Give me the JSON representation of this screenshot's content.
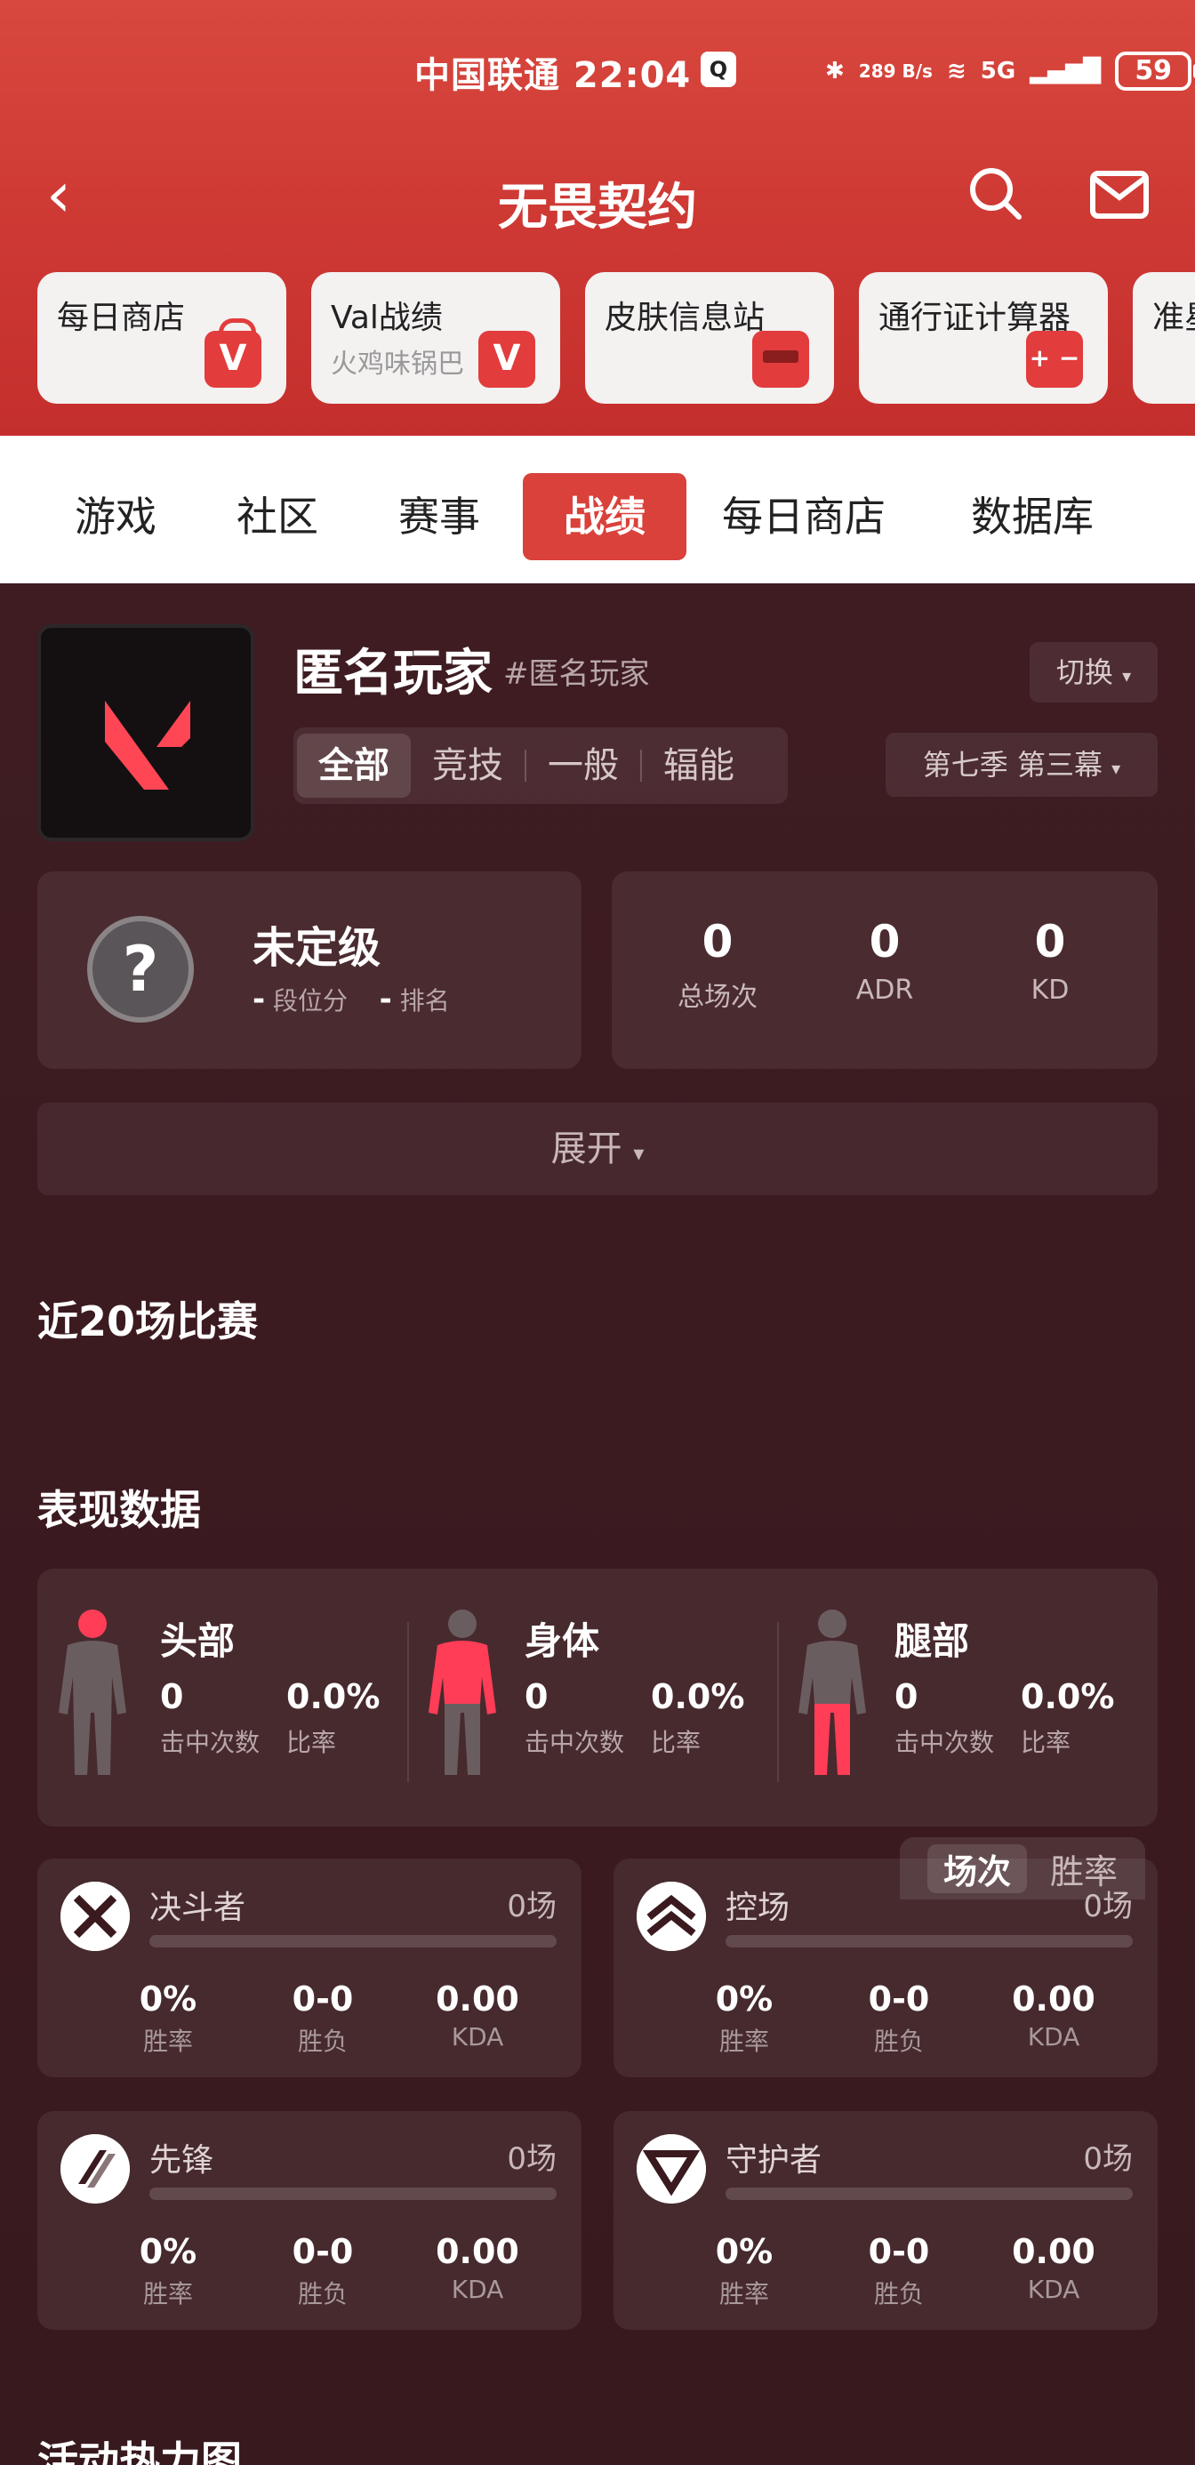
{
  "status": {
    "carrier_time": "中国联通 22:04",
    "net_speed": "289 B/s",
    "network": "5G",
    "battery": "59"
  },
  "header": {
    "title": "无畏契约"
  },
  "shortcuts": [
    {
      "title": "每日商店",
      "sub": ""
    },
    {
      "title": "Val战绩",
      "sub": "火鸡味锅巴"
    },
    {
      "title": "皮肤信息站",
      "sub": ""
    },
    {
      "title": "通行证计算器",
      "sub": ""
    },
    {
      "title": "准星",
      "sub": ""
    }
  ],
  "tabs": [
    "游戏",
    "社区",
    "赛事",
    "战绩",
    "每日商店",
    "数据库"
  ],
  "profile": {
    "name": "匿名玩家",
    "tag": "#匿名玩家",
    "switch_label": "切换",
    "modes": [
      "全部",
      "竞技",
      "一般",
      "辐能"
    ],
    "season": "第七季 第三幕"
  },
  "rank": {
    "title": "未定级",
    "points_value": "-",
    "points_label": "段位分",
    "rank_value": "-",
    "rank_label": "排名"
  },
  "summary": [
    {
      "value": "0",
      "label": "总场次"
    },
    {
      "value": "0",
      "label": "ADR"
    },
    {
      "value": "0",
      "label": "KD"
    }
  ],
  "expand_label": "展开",
  "recent_title": "近20场比赛",
  "performance": {
    "title": "表现数据",
    "parts": [
      {
        "name": "头部",
        "hits": "0",
        "hits_label": "击中次数",
        "rate": "0.0%",
        "rate_label": "比率"
      },
      {
        "name": "身体",
        "hits": "0",
        "hits_label": "击中次数",
        "rate": "0.0%",
        "rate_label": "比率"
      },
      {
        "name": "腿部",
        "hits": "0",
        "hits_label": "击中次数",
        "rate": "0.0%",
        "rate_label": "比率"
      }
    ]
  },
  "roles": [
    {
      "name": "决斗者",
      "count": "0场",
      "winrate": "0%",
      "winrate_label": "胜率",
      "wl": "0-0",
      "wl_label": "胜负",
      "kda": "0.00",
      "kda_label": "KDA"
    },
    {
      "name": "控场",
      "count": "0场",
      "winrate": "0%",
      "winrate_label": "胜率",
      "wl": "0-0",
      "wl_label": "胜负",
      "kda": "0.00",
      "kda_label": "KDA"
    },
    {
      "name": "先锋",
      "count": "0场",
      "winrate": "0%",
      "winrate_label": "胜率",
      "wl": "0-0",
      "wl_label": "胜负",
      "kda": "0.00",
      "kda_label": "KDA"
    },
    {
      "name": "守护者",
      "count": "0场",
      "winrate": "0%",
      "winrate_label": "胜率",
      "wl": "0-0",
      "wl_label": "胜负",
      "kda": "0.00",
      "kda_label": "KDA"
    }
  ],
  "heatmap": {
    "title": "活动热力图",
    "toggle_on": "场次",
    "toggle_off": "胜率"
  },
  "colors": {
    "brand_red": "#d9413a",
    "highlight_pink": "#ff3d57",
    "bg_dark": "#3a1a1f"
  }
}
